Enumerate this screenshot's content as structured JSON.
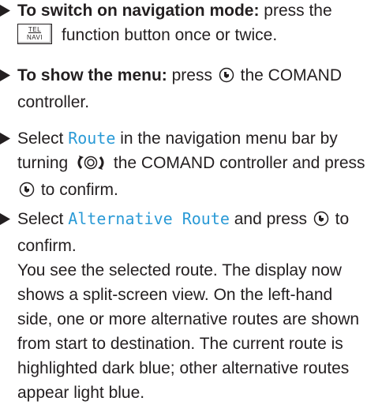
{
  "steps": [
    {
      "bold": "To switch on navigation mode:",
      "text_before_key": " press the",
      "key": {
        "top": "TEL",
        "bottom": "NAVI"
      },
      "text_after_key": "function button once or twice."
    },
    {
      "bold": "To show the menu:",
      "text_before_icon": " press",
      "text_after_icon": "the COMAND controller."
    },
    {
      "text_before_mono": "Select ",
      "mono": "Route",
      "text_middle": " in the navigation menu bar by turning",
      "text_after_turn": "the COMAND controller and press",
      "text_end": "to confirm."
    },
    {
      "text_before_mono": "Select ",
      "mono": "Alternative Route",
      "text_after_mono": " and press",
      "text_end": "to confirm.",
      "result": "You see the selected route. The display now shows a split-screen view. On the left-hand side, one or more alternative routes are shown from start to destination. The current route is highlighted dark blue; other alternative routes appear light blue."
    }
  ]
}
